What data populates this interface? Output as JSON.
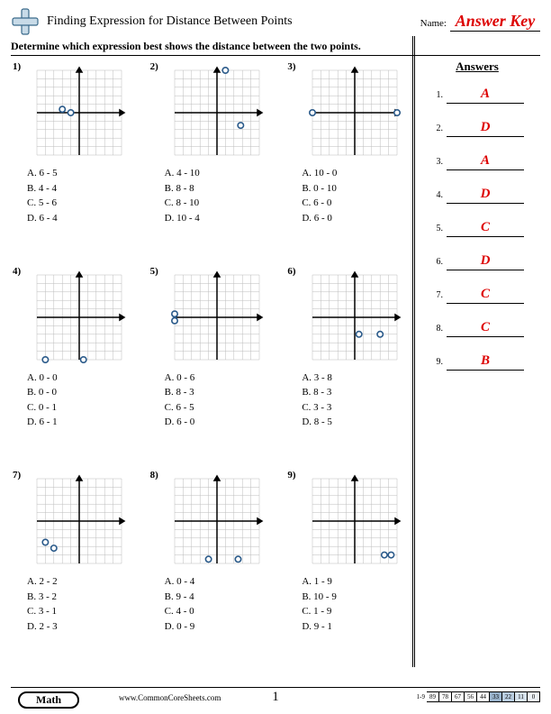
{
  "header": {
    "title": "Finding Expression for Distance Between Points",
    "name_label": "Name:",
    "answer_key": "Answer Key"
  },
  "instruction": "Determine which expression best shows the distance between the two points.",
  "answers_header": "Answers",
  "problems": [
    {
      "num": "1)",
      "points": [
        {
          "x": -2,
          "y": 0.4
        },
        {
          "x": -1,
          "y": 0
        }
      ],
      "choices": [
        "A. 6 - 5",
        "B. 4 - 4",
        "C. 5 - 6",
        "D. 6 - 4"
      ]
    },
    {
      "num": "2)",
      "points": [
        {
          "x": 1,
          "y": 5
        },
        {
          "x": 2.8,
          "y": -1.5
        }
      ],
      "choices": [
        "A. 4 - 10",
        "B. 8 - 8",
        "C. 8 - 10",
        "D. 10 - 4"
      ]
    },
    {
      "num": "3)",
      "points": [
        {
          "x": -5,
          "y": 0
        },
        {
          "x": 5,
          "y": 0
        }
      ],
      "choices": [
        "A. 10 - 0",
        "B. 0 - 10",
        "C. 6 - 0",
        "D. 6 - 0"
      ]
    },
    {
      "num": "4)",
      "points": [
        {
          "x": -4,
          "y": -5
        },
        {
          "x": 0.5,
          "y": -5
        }
      ],
      "choices": [
        "A. 0 - 0",
        "B. 0 - 0",
        "C. 0 - 1",
        "D. 6 - 1"
      ]
    },
    {
      "num": "5)",
      "points": [
        {
          "x": -5,
          "y": 0.4
        },
        {
          "x": -5,
          "y": -0.4
        }
      ],
      "choices": [
        "A. 0 - 6",
        "B. 8 - 3",
        "C. 6 - 5",
        "D. 6 - 0"
      ]
    },
    {
      "num": "6)",
      "points": [
        {
          "x": 0.5,
          "y": -2
        },
        {
          "x": 3,
          "y": -2
        }
      ],
      "choices": [
        "A. 3 - 8",
        "B. 8 - 3",
        "C. 3 - 3",
        "D. 8 - 5"
      ]
    },
    {
      "num": "7)",
      "points": [
        {
          "x": -4,
          "y": -2.5
        },
        {
          "x": -3,
          "y": -3.2
        }
      ],
      "choices": [
        "A. 2 - 2",
        "B. 3 - 2",
        "C. 3 - 1",
        "D. 2 - 3"
      ]
    },
    {
      "num": "8)",
      "points": [
        {
          "x": -1,
          "y": -4.5
        },
        {
          "x": 2.5,
          "y": -4.5
        }
      ],
      "choices": [
        "A. 0 - 4",
        "B. 9 - 4",
        "C. 4 - 0",
        "D. 0 - 9"
      ]
    },
    {
      "num": "9)",
      "points": [
        {
          "x": 3.5,
          "y": -4
        },
        {
          "x": 4.3,
          "y": -4
        }
      ],
      "choices": [
        "A. 1 - 9",
        "B. 10 - 9",
        "C. 1 - 9",
        "D. 9 - 1"
      ]
    }
  ],
  "answers": [
    "A",
    "D",
    "A",
    "D",
    "C",
    "D",
    "C",
    "C",
    "B"
  ],
  "footer": {
    "badge": "Math",
    "site": "www.CommonCoreSheets.com",
    "page": "1",
    "score_label": "1-9",
    "scores": [
      "89",
      "78",
      "67",
      "56",
      "44",
      "33",
      "22",
      "11",
      "0"
    ]
  }
}
